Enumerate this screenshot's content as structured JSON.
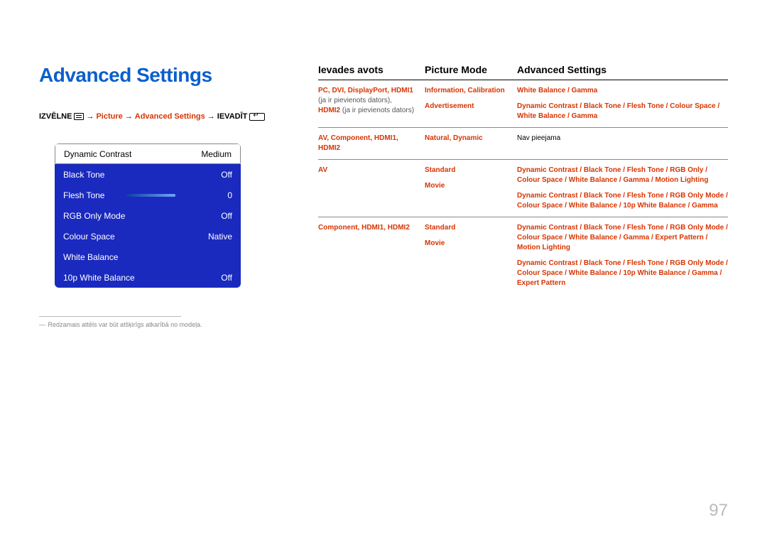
{
  "title": "Advanced Settings",
  "breadcrumb": {
    "menu": "IZVĒLNE",
    "picture": "Picture",
    "adv": "Advanced Settings",
    "enter": "IEVADĪT",
    "arrow": "→"
  },
  "settings": {
    "rows": [
      {
        "label": "Dynamic Contrast",
        "value": "Medium",
        "highlight": true
      },
      {
        "label": "Black Tone",
        "value": "Off"
      },
      {
        "label": "Flesh Tone",
        "value": "0",
        "slider": true
      },
      {
        "label": "RGB Only Mode",
        "value": "Off"
      },
      {
        "label": "Colour Space",
        "value": "Native"
      },
      {
        "label": "White Balance",
        "value": ""
      },
      {
        "label": "10p White Balance",
        "value": "Off"
      }
    ]
  },
  "footnote": {
    "dash": "―",
    "text": "Redzamais attēls var būt atšķirīgs atkarībā no modeļa."
  },
  "headers": {
    "source": "Ievades avots",
    "mode": "Picture Mode",
    "adv": "Advanced Settings"
  },
  "table": [
    {
      "source_red": "PC, DVI, DisplayPort, HDMI1",
      "source_sub1": "(ja ir pievienots dators),",
      "source_sub2_red": "HDMI2",
      "source_sub2_plain": " (ja ir pievienots dators)",
      "modes": [
        {
          "mode": "Information, Calibration",
          "adv": "White Balance / Gamma"
        },
        {
          "mode": "Advertisement",
          "adv": "Dynamic Contrast / Black Tone / Flesh Tone / Colour Space / White Balance / Gamma"
        }
      ]
    },
    {
      "source_red": "AV, Component, HDMI1, HDMI2",
      "modes": [
        {
          "mode": "Natural, Dynamic",
          "adv_plain": "Nav pieejama"
        }
      ]
    },
    {
      "source_red": "AV",
      "modes": [
        {
          "mode": "Standard",
          "adv": "Dynamic Contrast / Black Tone / Flesh Tone / RGB Only / Colour Space / White Balance / Gamma / Motion Lighting"
        },
        {
          "mode": "Movie",
          "adv": "Dynamic Contrast / Black Tone / Flesh Tone / RGB Only Mode / Colour Space / White Balance / 10p White Balance / Gamma"
        }
      ]
    },
    {
      "source_red": "Component, HDMI1, HDMI2",
      "modes": [
        {
          "mode": "Standard",
          "adv": "Dynamic Contrast / Black Tone / Flesh Tone / RGB Only Mode / Colour Space / White Balance / Gamma / Expert Pattern / Motion Lighting"
        },
        {
          "mode": "Movie",
          "adv": "Dynamic Contrast / Black Tone / Flesh Tone / RGB Only Mode / Colour Space / White Balance / 10p White Balance / Gamma / Expert Pattern"
        }
      ]
    }
  ],
  "page_num": "97"
}
